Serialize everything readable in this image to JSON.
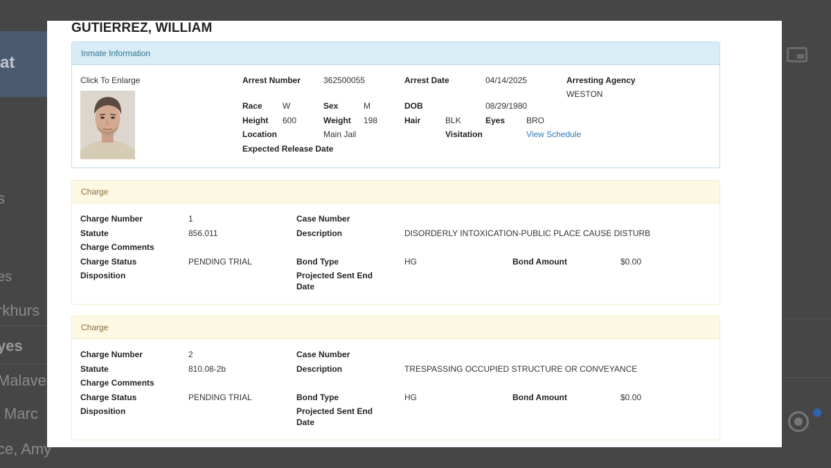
{
  "background": {
    "bubble_text": "at",
    "fragments": [
      "s",
      "es",
      "rkhurs",
      "yes",
      "Malave",
      "Marc",
      "ce, Amy"
    ]
  },
  "inmate": {
    "name": "GUTIERREZ, WILLIAM"
  },
  "info_panel": {
    "heading": "Inmate Information",
    "click_to_enlarge": "Click To Enlarge",
    "arrest_number_label": "Arrest Number",
    "arrest_number": "362500055",
    "arrest_date_label": "Arrest Date",
    "arrest_date": "04/14/2025",
    "arresting_agency_label": "Arresting Agency",
    "arresting_agency": "WESTON",
    "race_label": "Race",
    "race": "W",
    "sex_label": "Sex",
    "sex": "M",
    "dob_label": "DOB",
    "dob": "08/29/1980",
    "height_label": "Height",
    "height": "600",
    "weight_label": "Weight",
    "weight": "198",
    "hair_label": "Hair",
    "hair": "BLK",
    "eyes_label": "Eyes",
    "eyes": "BRO",
    "location_label": "Location",
    "location": "Main Jail",
    "visitation_label": "Visitation",
    "visitation_link": "View Schedule",
    "expected_release_label": "Expected Release Date"
  },
  "charges": [
    {
      "heading": "Charge",
      "charge_number_label": "Charge Number",
      "charge_number": "1",
      "case_number_label": "Case Number",
      "statute_label": "Statute",
      "statute": "856.011",
      "description_label": "Description",
      "description": "DISORDERLY INTOXICATION-PUBLIC PLACE CAUSE DISTURB",
      "comments_label": "Charge Comments",
      "status_label": "Charge Status",
      "status": "PENDING TRIAL",
      "bond_type_label": "Bond Type",
      "bond_type": "HG",
      "bond_amount_label": "Bond Amount",
      "bond_amount": "$0.00",
      "disposition_label": "Disposition",
      "projected_label": "Projected Sent End Date"
    },
    {
      "heading": "Charge",
      "charge_number_label": "Charge Number",
      "charge_number": "2",
      "case_number_label": "Case Number",
      "statute_label": "Statute",
      "statute": "810.08-2b",
      "description_label": "Description",
      "description": "TRESPASSING OCCUPIED STRUCTURE OR CONVEYANCE",
      "comments_label": "Charge Comments",
      "status_label": "Charge Status",
      "status": "PENDING TRIAL",
      "bond_type_label": "Bond Type",
      "bond_type": "HG",
      "bond_amount_label": "Bond Amount",
      "bond_amount": "$0.00",
      "disposition_label": "Disposition",
      "projected_label": "Projected Sent End Date"
    }
  ],
  "icons": {
    "pip": "picture-in-picture-icon",
    "radio": "radio-selected-icon",
    "notification": "notification-dot-icon"
  }
}
